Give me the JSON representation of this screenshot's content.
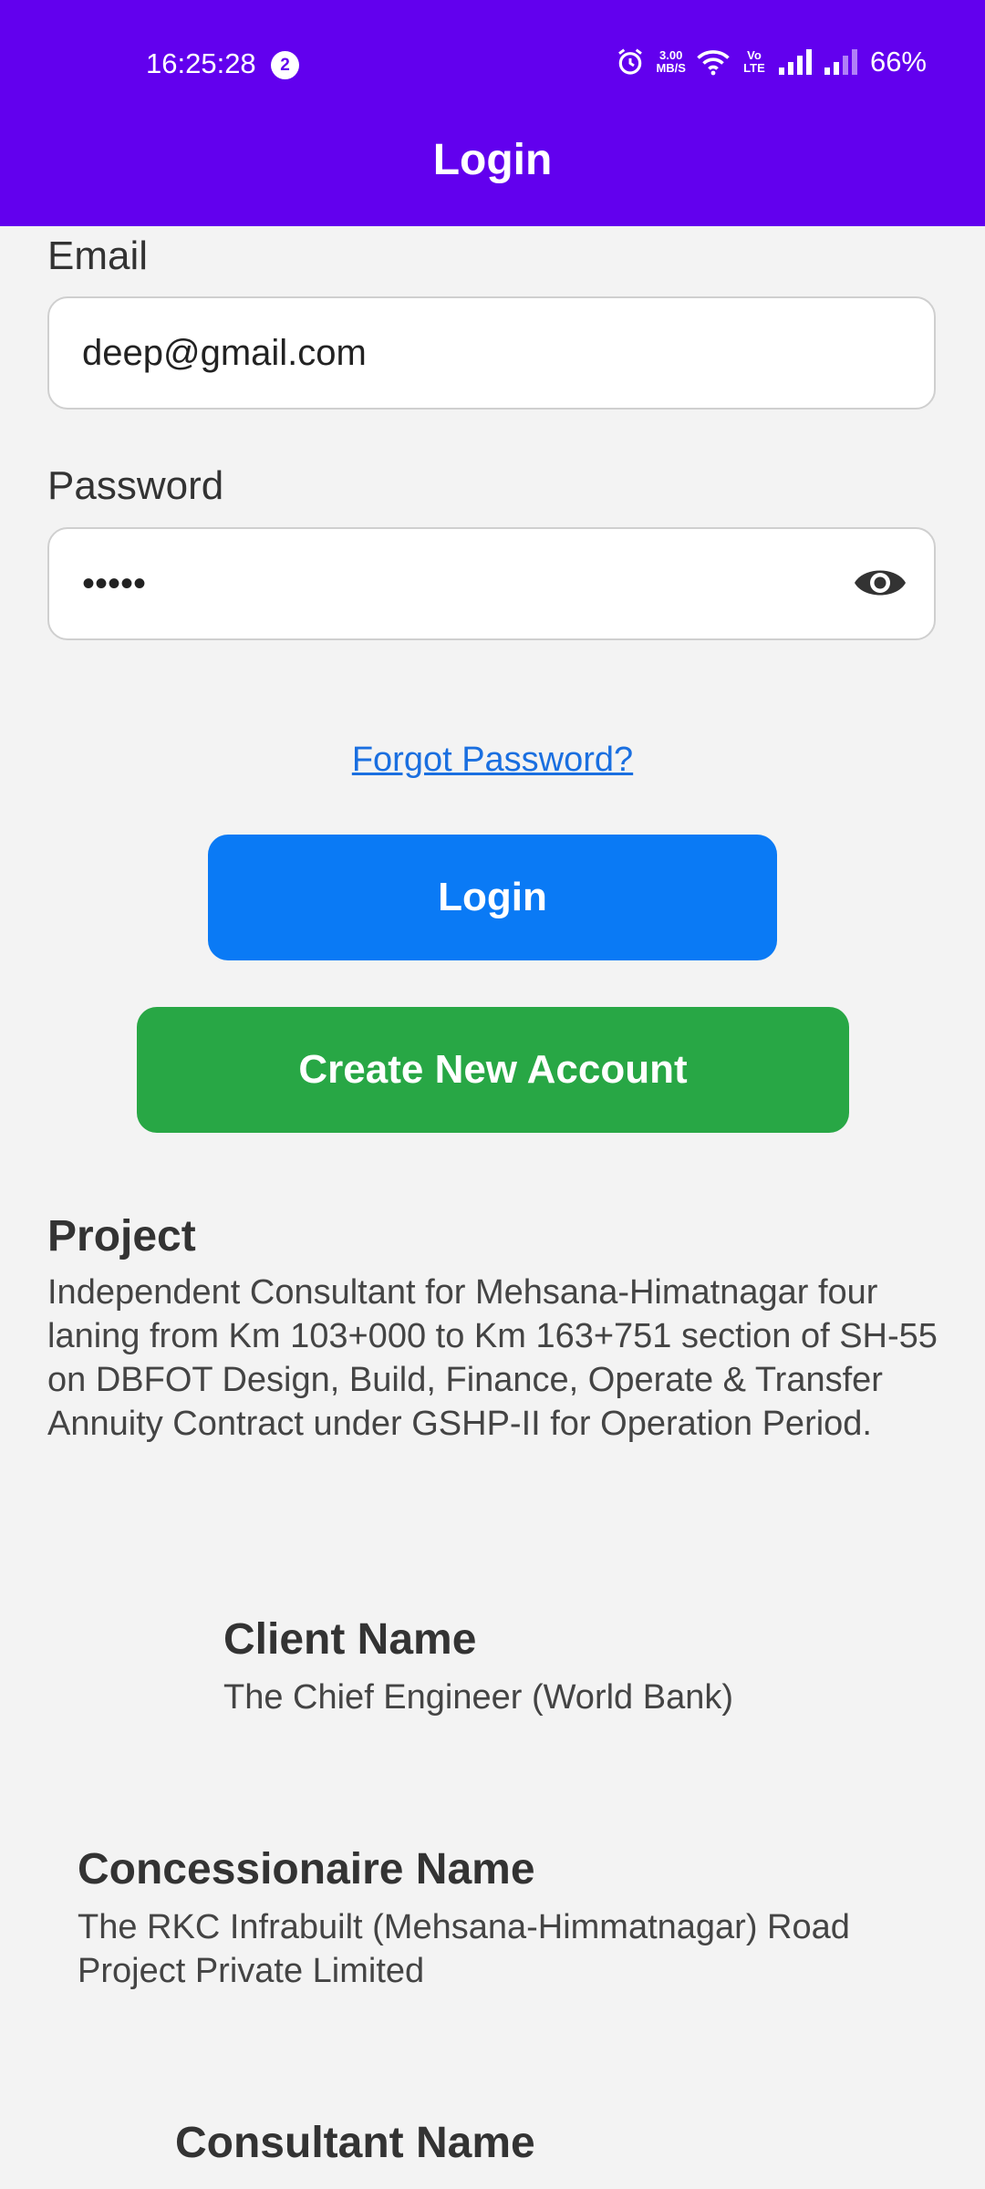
{
  "status_bar": {
    "time": "16:25:28",
    "notification_count": "2",
    "net_speed_top": "3.00",
    "net_speed_bottom": "MB/S",
    "volte": "Vo LTE",
    "battery": "66%"
  },
  "app_bar": {
    "title": "Login",
    "color": "#6200ee"
  },
  "email": {
    "label": "Email",
    "value": "deep@gmail.com"
  },
  "password": {
    "label": "Password",
    "value": "•••••"
  },
  "links": {
    "forgot": "Forgot Password?"
  },
  "buttons": {
    "login": "Login",
    "create_account": "Create New Account"
  },
  "project": {
    "title": "Project",
    "description": "Independent Consultant for Mehsana-Himatnagar four laning from Km 103+000 to Km 163+751 section of SH-55 on DBFOT Design, Build, Finance, Operate & Transfer Annuity Contract under GSHP-II for Operation Period."
  },
  "client": {
    "title": "Client Name",
    "value": "The Chief Engineer (World Bank)"
  },
  "concessionaire": {
    "title": "Concessionaire Name",
    "value": "The RKC Infrabuilt (Mehsana-Himmatnagar) Road Project Private Limited"
  },
  "consultant": {
    "title": "Consultant Name"
  }
}
